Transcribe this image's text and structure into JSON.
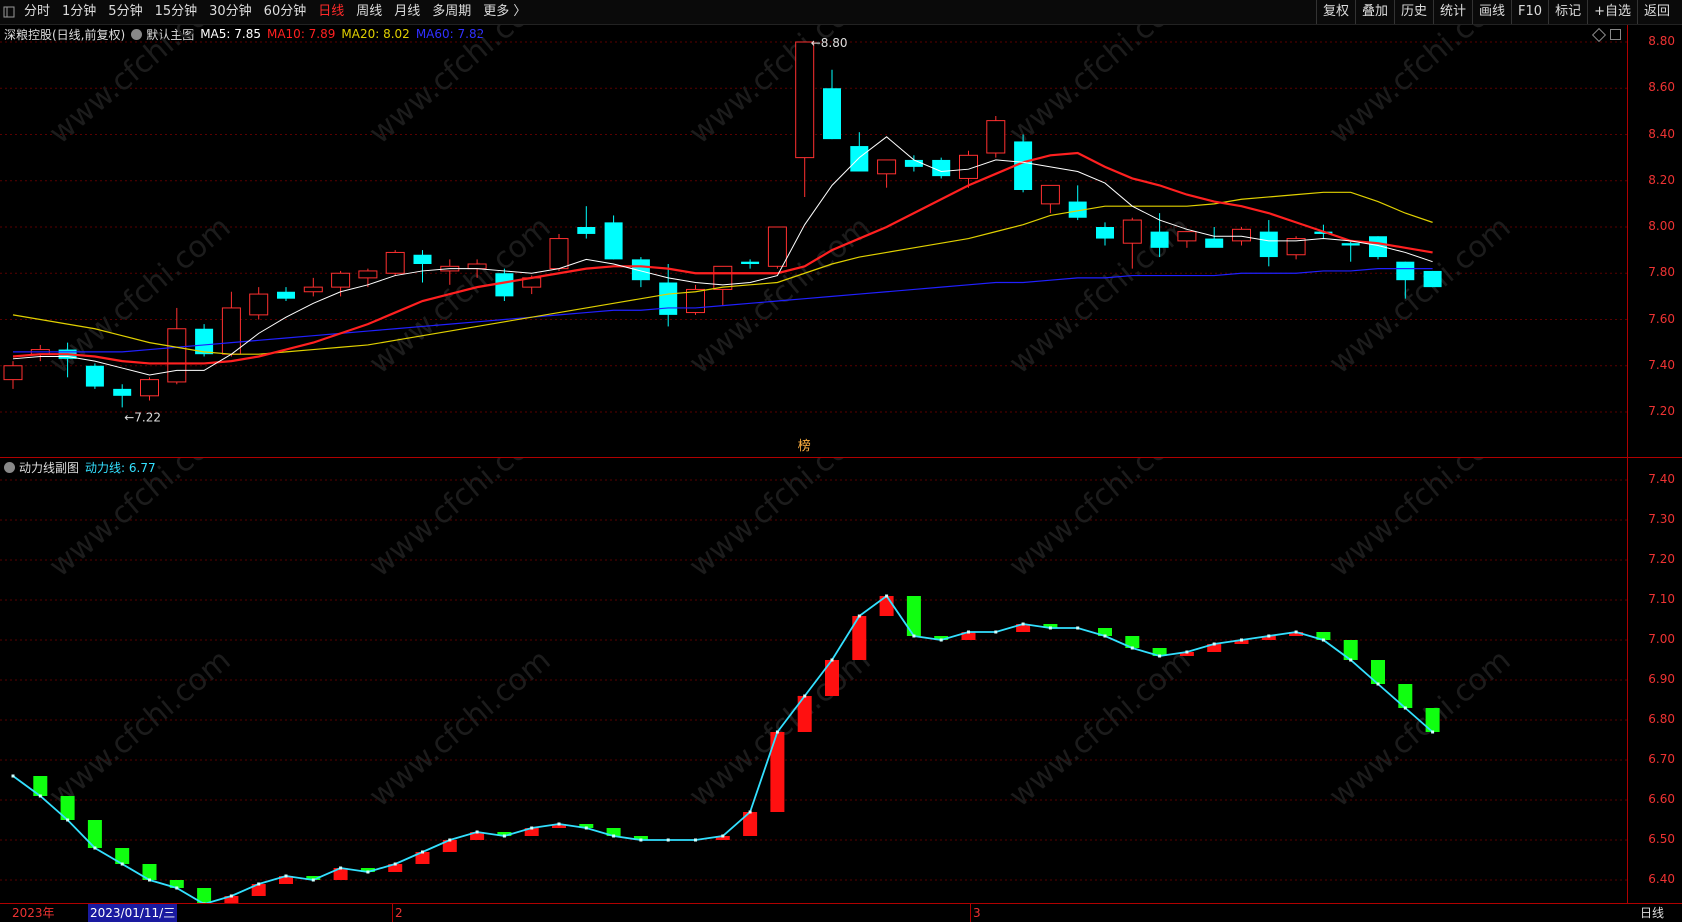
{
  "toolbar": {
    "periods": [
      "分时",
      "1分钟",
      "5分钟",
      "15分钟",
      "30分钟",
      "60分钟",
      "日线",
      "周线",
      "月线",
      "多周期",
      "更多 〉"
    ],
    "active_period": "日线",
    "actions": [
      "复权",
      "叠加",
      "历史",
      "统计",
      "画线",
      "F10",
      "标记",
      "+自选",
      "返回"
    ]
  },
  "main_pane": {
    "stock_title": "深粮控股(日线,前复权)",
    "chart_name": "默认主图",
    "ma5_label": "MA5: 7.85",
    "ma10_label": "MA10: 7.89",
    "ma20_label": "MA20: 8.02",
    "ma60_label": "MA60: 7.82",
    "colors": {
      "ma5": "#ffffff",
      "ma10": "#ff2020",
      "ma20": "#e0d000",
      "ma60": "#2020ff",
      "up": "#ff3030",
      "down": "#00ffff"
    },
    "high_marker": "8.80",
    "low_marker": "7.22",
    "badge": "榜",
    "y_ticks": [
      "8.80",
      "8.60",
      "8.40",
      "8.20",
      "8.00",
      "7.80",
      "7.60",
      "7.40",
      "7.20"
    ]
  },
  "sub_pane": {
    "title": "动力线副图",
    "value_label": "动力线: 6.77",
    "y_ticks": [
      "7.40",
      "7.30",
      "7.20",
      "7.10",
      "7.00",
      "6.90",
      "6.80",
      "6.70",
      "6.60",
      "6.50",
      "6.40"
    ]
  },
  "bottom_axis": {
    "year_label": "2023年",
    "cursor_date": "2023/01/11/三",
    "month_labels": [
      "2",
      "3"
    ],
    "period_label": "日线"
  },
  "watermark": "www.cfchi.com",
  "chart_data": [
    {
      "type": "candlestick",
      "ylim": [
        7.2,
        8.8
      ],
      "ohlc": [
        [
          7.34,
          7.42,
          7.3,
          7.4
        ],
        [
          7.45,
          7.49,
          7.42,
          7.47
        ],
        [
          7.47,
          7.5,
          7.35,
          7.43
        ],
        [
          7.4,
          7.41,
          7.3,
          7.31
        ],
        [
          7.3,
          7.32,
          7.22,
          7.27
        ],
        [
          7.27,
          7.35,
          7.25,
          7.34
        ],
        [
          7.33,
          7.65,
          7.32,
          7.56
        ],
        [
          7.56,
          7.58,
          7.44,
          7.45
        ],
        [
          7.45,
          7.72,
          7.44,
          7.65
        ],
        [
          7.62,
          7.74,
          7.6,
          7.71
        ],
        [
          7.72,
          7.74,
          7.68,
          7.69
        ],
        [
          7.72,
          7.78,
          7.7,
          7.74
        ],
        [
          7.74,
          7.81,
          7.7,
          7.8
        ],
        [
          7.78,
          7.82,
          7.74,
          7.81
        ],
        [
          7.8,
          7.9,
          7.79,
          7.89
        ],
        [
          7.88,
          7.9,
          7.76,
          7.84
        ],
        [
          7.81,
          7.86,
          7.75,
          7.83
        ],
        [
          7.82,
          7.86,
          7.78,
          7.84
        ],
        [
          7.8,
          7.82,
          7.68,
          7.7
        ],
        [
          7.74,
          7.79,
          7.71,
          7.78
        ],
        [
          7.82,
          7.97,
          7.81,
          7.95
        ],
        [
          8.0,
          8.09,
          7.95,
          7.97
        ],
        [
          8.02,
          8.05,
          7.86,
          7.86
        ],
        [
          7.86,
          7.87,
          7.74,
          7.77
        ],
        [
          7.76,
          7.84,
          7.57,
          7.62
        ],
        [
          7.63,
          7.75,
          7.62,
          7.73
        ],
        [
          7.73,
          7.82,
          7.66,
          7.83
        ],
        [
          7.85,
          7.86,
          7.82,
          7.84
        ],
        [
          7.83,
          8.0,
          7.82,
          8.0
        ],
        [
          8.3,
          8.8,
          8.13,
          8.8
        ],
        [
          8.6,
          8.68,
          8.38,
          8.38
        ],
        [
          8.35,
          8.41,
          8.24,
          8.24
        ],
        [
          8.23,
          8.29,
          8.17,
          8.29
        ],
        [
          8.29,
          8.31,
          8.24,
          8.26
        ],
        [
          8.29,
          8.3,
          8.21,
          8.22
        ],
        [
          8.21,
          8.33,
          8.17,
          8.31
        ],
        [
          8.32,
          8.48,
          8.3,
          8.46
        ],
        [
          8.37,
          8.4,
          8.15,
          8.16
        ],
        [
          8.1,
          8.18,
          8.06,
          8.18
        ],
        [
          8.11,
          8.18,
          8.03,
          8.04
        ],
        [
          8.0,
          8.02,
          7.92,
          7.95
        ],
        [
          7.93,
          8.04,
          7.82,
          8.03
        ],
        [
          7.98,
          8.06,
          7.87,
          7.91
        ],
        [
          7.94,
          7.98,
          7.91,
          7.98
        ],
        [
          7.95,
          8.0,
          7.92,
          7.91
        ],
        [
          7.94,
          8.0,
          7.92,
          7.99
        ],
        [
          7.98,
          8.03,
          7.83,
          7.87
        ],
        [
          7.88,
          7.96,
          7.86,
          7.95
        ],
        [
          7.98,
          8.01,
          7.95,
          7.97
        ],
        [
          7.93,
          7.94,
          7.85,
          7.92
        ],
        [
          7.96,
          7.96,
          7.86,
          7.87
        ],
        [
          7.85,
          7.85,
          7.69,
          7.77
        ],
        [
          7.81,
          7.81,
          7.74,
          7.74
        ]
      ],
      "ma5": [
        7.43,
        7.44,
        7.44,
        7.42,
        7.39,
        7.36,
        7.38,
        7.38,
        7.45,
        7.54,
        7.61,
        7.67,
        7.72,
        7.75,
        7.79,
        7.81,
        7.82,
        7.82,
        7.81,
        7.8,
        7.82,
        7.86,
        7.84,
        7.81,
        7.78,
        7.76,
        7.75,
        7.76,
        7.79,
        8.01,
        8.18,
        8.3,
        8.39,
        8.29,
        8.24,
        8.25,
        8.29,
        8.28,
        8.26,
        8.24,
        8.19,
        8.09,
        8.03,
        7.99,
        7.96,
        7.96,
        7.94,
        7.94,
        7.95,
        7.94,
        7.92,
        7.89,
        7.85
      ],
      "ma10": [
        7.44,
        7.45,
        7.45,
        7.44,
        7.42,
        7.41,
        7.41,
        7.41,
        7.42,
        7.44,
        7.47,
        7.5,
        7.54,
        7.58,
        7.63,
        7.68,
        7.71,
        7.74,
        7.76,
        7.78,
        7.8,
        7.82,
        7.83,
        7.83,
        7.82,
        7.8,
        7.8,
        7.8,
        7.8,
        7.83,
        7.9,
        7.95,
        8.0,
        8.06,
        8.12,
        8.18,
        8.23,
        8.28,
        8.31,
        8.32,
        8.26,
        8.21,
        8.18,
        8.14,
        8.11,
        8.09,
        8.06,
        8.02,
        7.98,
        7.94,
        7.93,
        7.91,
        7.89
      ],
      "ma20": [
        7.62,
        7.6,
        7.58,
        7.56,
        7.53,
        7.5,
        7.48,
        7.46,
        7.45,
        7.45,
        7.46,
        7.47,
        7.48,
        7.49,
        7.51,
        7.53,
        7.55,
        7.57,
        7.59,
        7.61,
        7.63,
        7.65,
        7.67,
        7.69,
        7.71,
        7.72,
        7.74,
        7.75,
        7.76,
        7.8,
        7.84,
        7.87,
        7.89,
        7.91,
        7.93,
        7.95,
        7.98,
        8.01,
        8.05,
        8.07,
        8.09,
        8.09,
        8.09,
        8.09,
        8.1,
        8.12,
        8.13,
        8.14,
        8.15,
        8.15,
        8.11,
        8.06,
        8.02
      ],
      "ma60": [
        7.46,
        7.46,
        7.46,
        7.46,
        7.46,
        7.47,
        7.48,
        7.49,
        7.5,
        7.51,
        7.52,
        7.53,
        7.54,
        7.55,
        7.56,
        7.57,
        7.58,
        7.59,
        7.6,
        7.61,
        7.62,
        7.63,
        7.64,
        7.64,
        7.65,
        7.65,
        7.66,
        7.67,
        7.68,
        7.69,
        7.7,
        7.71,
        7.72,
        7.73,
        7.74,
        7.75,
        7.76,
        7.76,
        7.77,
        7.78,
        7.78,
        7.79,
        7.79,
        7.79,
        7.79,
        7.8,
        7.8,
        7.8,
        7.81,
        7.81,
        7.82,
        7.82,
        7.82
      ]
    },
    {
      "type": "bar",
      "series": [
        {
          "name": "动力线",
          "values": [
            6.66,
            6.61,
            6.55,
            6.48,
            6.44,
            6.4,
            6.38,
            6.34,
            6.36,
            6.39,
            6.41,
            6.4,
            6.43,
            6.42,
            6.44,
            6.47,
            6.5,
            6.52,
            6.51,
            6.53,
            6.54,
            6.53,
            6.51,
            6.5,
            6.5,
            6.5,
            6.51,
            6.57,
            6.77,
            6.86,
            6.95,
            7.06,
            7.11,
            7.01,
            7.0,
            7.02,
            7.02,
            7.04,
            7.03,
            7.03,
            7.01,
            6.98,
            6.96,
            6.97,
            6.99,
            7.0,
            7.01,
            7.02,
            7.0,
            6.95,
            6.89,
            6.83,
            6.77
          ]
        }
      ],
      "ylim": [
        6.35,
        7.45
      ]
    }
  ]
}
